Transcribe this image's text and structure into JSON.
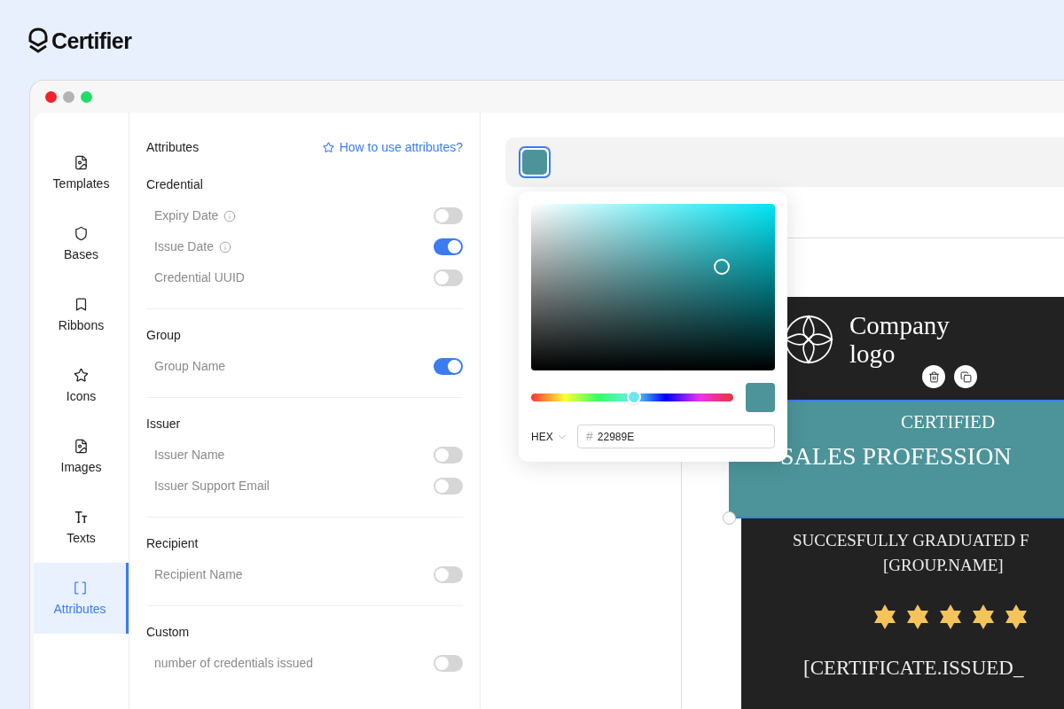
{
  "brand": {
    "name": "Certifier"
  },
  "sidebar": {
    "items": [
      {
        "label": "Templates",
        "kind": "file",
        "selected": false
      },
      {
        "label": "Bases",
        "kind": "shield",
        "selected": false
      },
      {
        "label": "Ribbons",
        "kind": "bookmark",
        "selected": false
      },
      {
        "label": "Icons",
        "kind": "star",
        "selected": false
      },
      {
        "label": "Images",
        "kind": "file",
        "selected": false
      },
      {
        "label": "Texts",
        "kind": "type",
        "selected": false
      },
      {
        "label": "Attributes",
        "kind": "brackets",
        "selected": true
      }
    ]
  },
  "panel": {
    "title": "Attributes",
    "help_link": "How to use attributes?",
    "sections": [
      {
        "title": "Credential",
        "items": [
          {
            "label": "Expiry Date",
            "info": true,
            "on": false
          },
          {
            "label": "Issue Date",
            "info": true,
            "on": true
          },
          {
            "label": "Credential UUID",
            "info": false,
            "on": false
          }
        ]
      },
      {
        "title": "Group",
        "items": [
          {
            "label": "Group Name",
            "info": false,
            "on": true
          }
        ]
      },
      {
        "title": "Issuer",
        "items": [
          {
            "label": "Issuer Name",
            "info": false,
            "on": false
          },
          {
            "label": "Issuer Support Email",
            "info": false,
            "on": false
          }
        ]
      },
      {
        "title": "Recipient",
        "items": [
          {
            "label": "Recipient Name",
            "info": false,
            "on": false
          }
        ]
      },
      {
        "title": "Custom",
        "items": [
          {
            "label": "number of credentials issued",
            "info": false,
            "on": false
          }
        ]
      }
    ]
  },
  "color_picker": {
    "hue": {
      "level": 0.51
    },
    "format": "HEX",
    "hash": "#",
    "value": "22989E"
  },
  "certificate": {
    "logo_text": "Company logo",
    "band_top": "CERTIFIED",
    "band_title": "SALES PROFESSION",
    "line_1": "SUCCESFULLY GRADUATED F",
    "line_2": "[GROUP.NAME]",
    "line_3": "[CERTIFICATE.ISSUED_"
  }
}
